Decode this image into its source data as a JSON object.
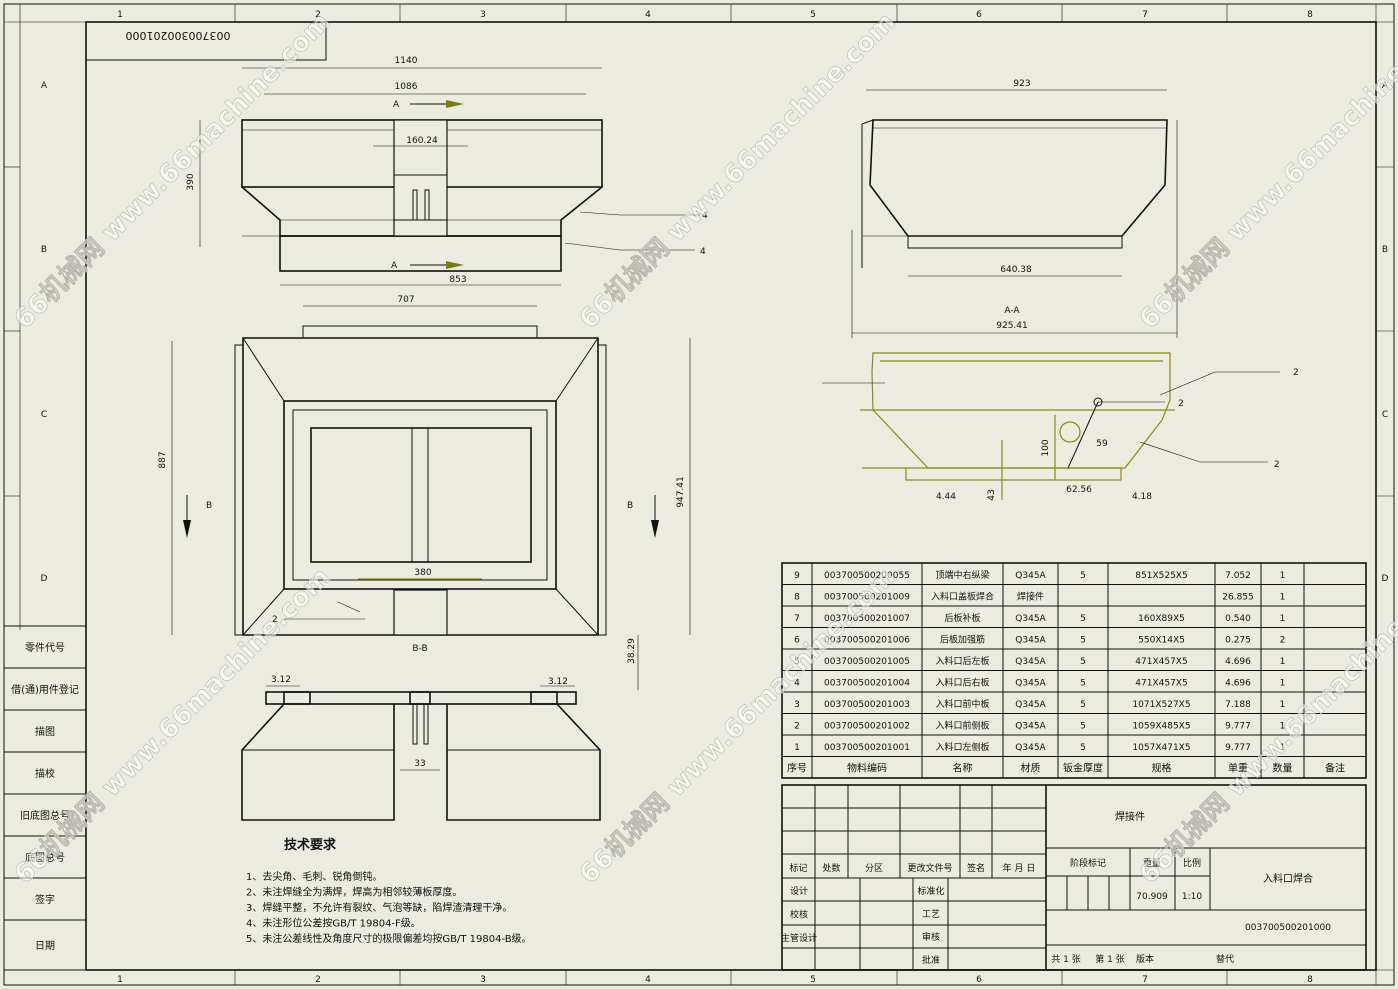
{
  "drawing_code_top": "003700300201000",
  "zones": {
    "columns": [
      "1",
      "2",
      "3",
      "4",
      "5",
      "6",
      "7",
      "8"
    ],
    "rows": [
      "A",
      "B",
      "C",
      "D"
    ]
  },
  "left_column_labels": [
    "零件代号",
    "借(通)用件登记",
    "描图",
    "描校",
    "旧底图总号",
    "底图总号",
    "签字",
    "日期"
  ],
  "views": {
    "front": {
      "dims": {
        "overall_width": "1140",
        "inner_width": "1086",
        "gap_width": "160.24",
        "height": "390",
        "bottom_width": "853"
      },
      "section_marker": "A",
      "balloons": [
        "4",
        "4"
      ]
    },
    "top": {
      "dims": {
        "top_width": "707",
        "height": "887",
        "side_height": "947.41",
        "opening": "380"
      },
      "section_marker": "B",
      "title": "B-B",
      "balloon": "2"
    },
    "bottom_front": {
      "dims": {
        "left_gap": "3.12",
        "right_gap": "3.12",
        "center": "33",
        "right_height": "38.29"
      }
    },
    "section_aa": {
      "dims": {
        "top_width": "923",
        "bottom_width": "640.38",
        "overall_width": "925.41"
      },
      "title": "A-A"
    },
    "side_detail": {
      "dims": {
        "d100": "100",
        "d59": "59",
        "d62_56": "62.56",
        "d4_44": "4.44",
        "d43": "43",
        "d4_18": "4.18"
      },
      "balloons": [
        "2",
        "2",
        "2"
      ]
    }
  },
  "tech_requirements": {
    "title": "技术要求",
    "items": [
      "1、去尖角、毛刺、锐角倒钝。",
      "2、未注焊缝全为满焊，焊高为相邻较薄板厚度。",
      "3、焊缝平整，不允许有裂纹、气泡等缺，陷焊渣清理干净。",
      "4、未注形位公差按GB/T 19804-F级。",
      "5、未注公差线性及角度尺寸的极限偏差均按GB/T 19804-B级。"
    ]
  },
  "bom": {
    "headers": [
      "序号",
      "物料编码",
      "名称",
      "材质",
      "钣金厚度",
      "规格",
      "单重",
      "数量",
      "备注"
    ],
    "rows": [
      {
        "no": "9",
        "code": "003700500200055",
        "name": "顶端中右纵梁",
        "material": "Q345A",
        "thickness": "5",
        "spec": "851X525X5",
        "weight": "7.052",
        "qty": "1",
        "note": ""
      },
      {
        "no": "8",
        "code": "003700500201009",
        "name": "入料口盖板焊合",
        "material": "焊接件",
        "thickness": "",
        "spec": "",
        "weight": "26.855",
        "qty": "1",
        "note": ""
      },
      {
        "no": "7",
        "code": "003700500201007",
        "name": "后板补板",
        "material": "Q345A",
        "thickness": "5",
        "spec": "160X89X5",
        "weight": "0.540",
        "qty": "1",
        "note": ""
      },
      {
        "no": "6",
        "code": "003700500201006",
        "name": "后板加强筋",
        "material": "Q345A",
        "thickness": "5",
        "spec": "550X14X5",
        "weight": "0.275",
        "qty": "2",
        "note": ""
      },
      {
        "no": "5",
        "code": "003700500201005",
        "name": "入料口后左板",
        "material": "Q345A",
        "thickness": "5",
        "spec": "471X457X5",
        "weight": "4.696",
        "qty": "1",
        "note": ""
      },
      {
        "no": "4",
        "code": "003700500201004",
        "name": "入料口后右板",
        "material": "Q345A",
        "thickness": "5",
        "spec": "471X457X5",
        "weight": "4.696",
        "qty": "1",
        "note": ""
      },
      {
        "no": "3",
        "code": "003700500201003",
        "name": "入料口前中板",
        "material": "Q345A",
        "thickness": "5",
        "spec": "1071X527X5",
        "weight": "7.188",
        "qty": "1",
        "note": ""
      },
      {
        "no": "2",
        "code": "003700500201002",
        "name": "入料口前侧板",
        "material": "Q345A",
        "thickness": "5",
        "spec": "1059X485X5",
        "weight": "9.777",
        "qty": "1",
        "note": ""
      },
      {
        "no": "1",
        "code": "003700500201001",
        "name": "入料口左侧板",
        "material": "Q345A",
        "thickness": "5",
        "spec": "1057X471X5",
        "weight": "9.777",
        "qty": "1",
        "note": ""
      }
    ]
  },
  "title_block": {
    "type": "焊接件",
    "rev_headers": [
      "标记",
      "处数",
      "分区",
      "更改文件号",
      "签名",
      "年 月 日"
    ],
    "roles_left": [
      "设计",
      "校核",
      "主管设计"
    ],
    "roles_mid": [
      "标准化",
      "工艺",
      "审核",
      "批准"
    ],
    "stage_label": "阶段标记",
    "weight_label": "重量",
    "scale_label": "比例",
    "weight": "70.909",
    "scale": "1:10",
    "part_name": "入料口焊合",
    "part_code": "003700500201000",
    "sheet_total": "共 1 张",
    "sheet_no": "第 1 张",
    "version": "版本",
    "replace": "替代"
  },
  "watermark": "66机械网 www.66machine.com"
}
